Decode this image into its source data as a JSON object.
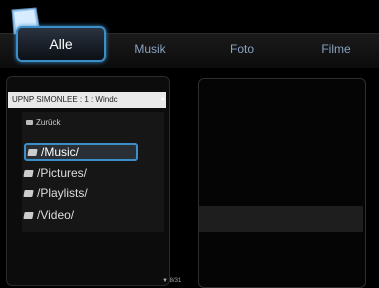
{
  "tabs": [
    {
      "label": "Alle",
      "active": true
    },
    {
      "label": "Musik"
    },
    {
      "label": "Foto"
    },
    {
      "label": "Filme"
    }
  ],
  "browser": {
    "header": "UPNP SIMONLEE : 1 : Windc",
    "back_label": "Zurück",
    "items": [
      {
        "label": "/Music/",
        "selected": true
      },
      {
        "label": "/Pictures/"
      },
      {
        "label": "/Playlists/"
      },
      {
        "label": "/Video/"
      }
    ],
    "pager": "8/31"
  },
  "colors": {
    "accent": "#3a8fc8",
    "background": "#000000"
  },
  "icons": {
    "logo": "app-logo-icon",
    "folder": "folder-icon",
    "file": "network-folder-icon"
  }
}
